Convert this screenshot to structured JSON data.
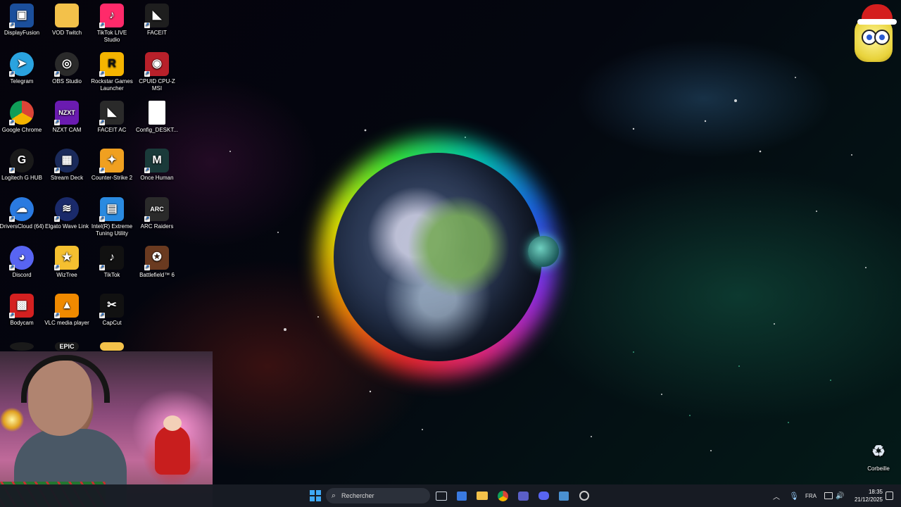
{
  "desktop": {
    "icons": [
      {
        "label": "DisplayFusion",
        "icon": "displayfusion-icon",
        "color": "#1b4f9c"
      },
      {
        "label": "VOD Twitch",
        "icon": "folder-icon",
        "color": "#f3c14a"
      },
      {
        "label": "TikTok LIVE Studio",
        "icon": "tiktok-live-icon",
        "color": "#ff2a6a"
      },
      {
        "label": "FACEIT",
        "icon": "faceit-icon",
        "color": "#1e1e1e"
      },
      {
        "label": "Telegram",
        "icon": "telegram-icon",
        "color": "#2aa3df"
      },
      {
        "label": "OBS Studio",
        "icon": "obs-icon",
        "color": "#2a2a2a"
      },
      {
        "label": "Rockstar Games Launcher",
        "icon": "rockstar-icon",
        "color": "#f5b400"
      },
      {
        "label": "CPUID CPU-Z MSI",
        "icon": "cpuz-icon",
        "color": "#b8202a"
      },
      {
        "label": "Google Chrome",
        "icon": "chrome-icon",
        "color": "#2f8f3a"
      },
      {
        "label": "NZXT CAM",
        "icon": "nzxt-icon",
        "color": "#6a1bb0"
      },
      {
        "label": "FACEIT AC",
        "icon": "faceit-ac-icon",
        "color": "#2a2a2a"
      },
      {
        "label": "Config_DESKT...",
        "icon": "file-icon",
        "color": "#ffffff"
      },
      {
        "label": "Logitech G HUB",
        "icon": "logitech-icon",
        "color": "#1a1a1a"
      },
      {
        "label": "Stream Deck",
        "icon": "stream-deck-icon",
        "color": "#1a2a5a"
      },
      {
        "label": "Counter-Strike 2",
        "icon": "cs2-icon",
        "color": "#f0a020"
      },
      {
        "label": "Once Human",
        "icon": "once-human-icon",
        "color": "#1a3a3a"
      },
      {
        "label": "DriversCloud (64)",
        "icon": "driverscloud-icon",
        "color": "#2a7ae0"
      },
      {
        "label": "Elgato Wave Link",
        "icon": "wave-link-icon",
        "color": "#1a2a6a"
      },
      {
        "label": "Intel(R) Extreme Tuning Utility",
        "icon": "intel-xtu-icon",
        "color": "#2a8ae0"
      },
      {
        "label": "ARC Raiders",
        "icon": "arc-raiders-icon",
        "color": "#2a2a2a"
      },
      {
        "label": "Discord",
        "icon": "discord-icon",
        "color": "#5865f2"
      },
      {
        "label": "WizTree",
        "icon": "wiztree-icon",
        "color": "#f5c030"
      },
      {
        "label": "TikTok",
        "icon": "tiktok-icon",
        "color": "#111111"
      },
      {
        "label": "Battlefield™ 6",
        "icon": "battlefield-icon",
        "color": "#6a3a20"
      },
      {
        "label": "Bodycam",
        "icon": "bodycam-icon",
        "color": "#d42020"
      },
      {
        "label": "VLC media player",
        "icon": "vlc-icon",
        "color": "#f08a00"
      },
      {
        "label": "CapCut",
        "icon": "capcut-icon",
        "color": "#111111"
      }
    ],
    "partial_icon_text": "EPIC",
    "recycle_bin": "Corbeille"
  },
  "taskbar": {
    "search_placeholder": "Rechercher",
    "apps": [
      "start-icon",
      "task-view-icon",
      "store-icon",
      "file-explorer-icon",
      "chrome-icon",
      "teams-icon",
      "discord-icon",
      "control-panel-icon",
      "cpuz-icon"
    ],
    "language": "FRA",
    "time": "18:35",
    "date": "21/12/2025"
  }
}
